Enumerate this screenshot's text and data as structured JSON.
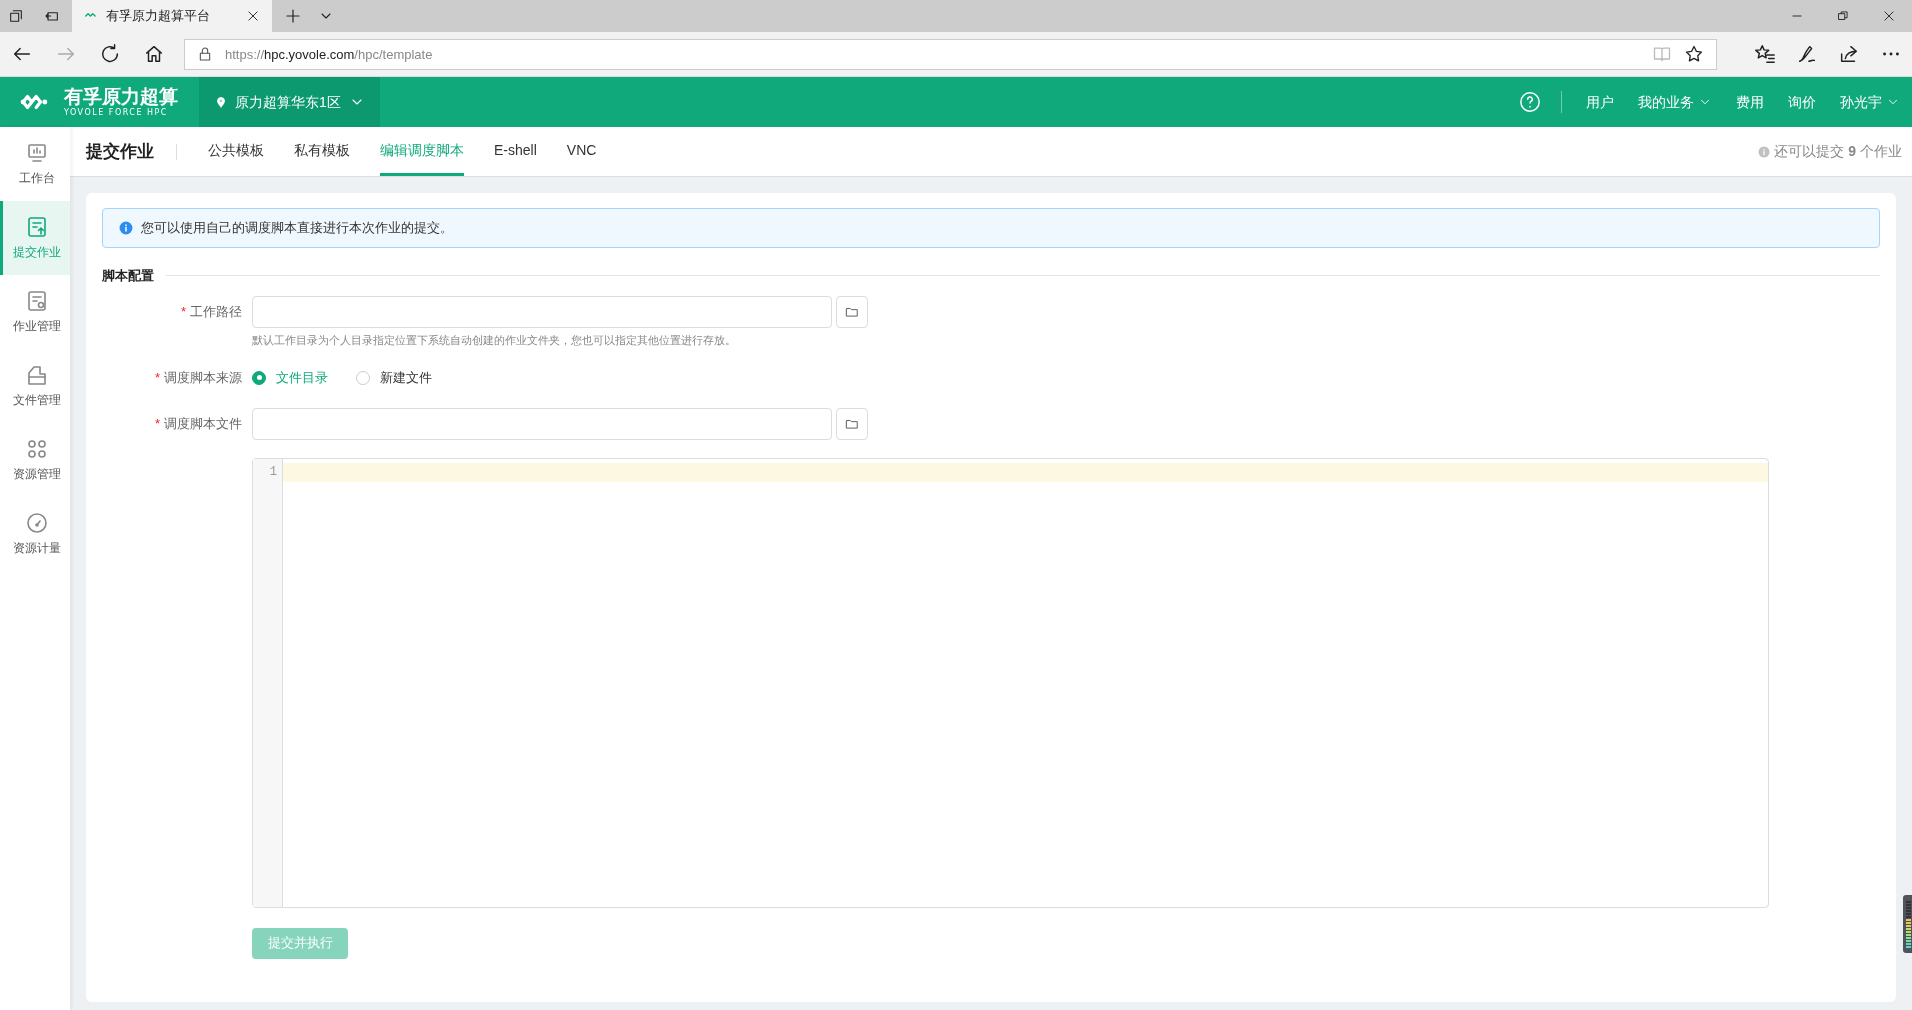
{
  "browser": {
    "tab_title": "有孚原力超算平台",
    "url": {
      "scheme": "https://",
      "host": "hpc.yovole.com",
      "path": "/hpc/template"
    }
  },
  "header": {
    "logo_name": "有孚原力超算",
    "logo_tagline": "YOVOLE FORCE HPC",
    "region": "原力超算华东1区",
    "nav": [
      {
        "label": "用户",
        "dropdown": false
      },
      {
        "label": "我的业务",
        "dropdown": true
      },
      {
        "label": "费用",
        "dropdown": false
      },
      {
        "label": "询价",
        "dropdown": false
      },
      {
        "label": "孙光宇",
        "dropdown": true
      }
    ]
  },
  "sidebar": {
    "items": [
      {
        "kind": "dashboard",
        "label": "工作台",
        "selected": false
      },
      {
        "kind": "submit",
        "label": "提交作业",
        "selected": true
      },
      {
        "kind": "jobs",
        "label": "作业管理",
        "selected": false
      },
      {
        "kind": "files",
        "label": "文件管理",
        "selected": false
      },
      {
        "kind": "resources",
        "label": "资源管理",
        "selected": false
      },
      {
        "kind": "metering",
        "label": "资源计量",
        "selected": false
      }
    ]
  },
  "page": {
    "title": "提交作业",
    "tabs": [
      {
        "label": "公共模板",
        "selected": false
      },
      {
        "label": "私有模板",
        "selected": false
      },
      {
        "label": "编辑调度脚本",
        "selected": true
      },
      {
        "label": "E-shell",
        "selected": false
      },
      {
        "label": "VNC",
        "selected": false
      }
    ],
    "quota": "还可以提交 **9** 个作业"
  },
  "alert": "您可以使用自己的调度脚本直接进行本次作业的提交。",
  "section_title": "脚本配置",
  "form": [
    {
      "kind": "path",
      "label": "工作路径",
      "required_mark": "*",
      "hint": "默认工作目录为个人目录指定位置下系统自动创建的作业文件夹，您也可以指定其他位置进行存放。"
    },
    {
      "kind": "radio",
      "label": "调度脚本来源",
      "required_mark": "*",
      "options": [
        {
          "label": "文件目录",
          "selected": true
        },
        {
          "label": "新建文件",
          "selected": false
        }
      ]
    },
    {
      "kind": "path",
      "label": "调度脚本文件",
      "required_mark": "*"
    }
  ],
  "editor": {
    "line_numbers": [
      "1"
    ]
  },
  "submit": {
    "label": "提交并执行",
    "disabled": true
  }
}
